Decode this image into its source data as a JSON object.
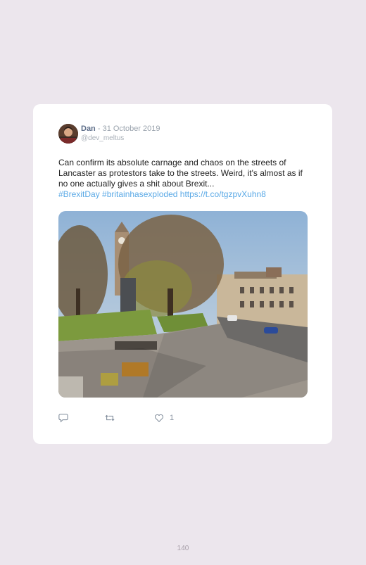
{
  "tweet": {
    "author": "Dan",
    "date": "31 October 2019",
    "handle": "@dev_meltus",
    "text": "Can confirm its absolute carnage and chaos on the streets of Lancaster as protestors take to the streets. Weird, it's almost as if no one actually gives a shit about Brexit...",
    "hashtags": "#BrexitDay #britainhasexploded",
    "url": "https://t.co/tgzpvXuhn8",
    "like_count": "1"
  },
  "icons": {
    "reply": "speech-bubble-icon",
    "retweet": "retweet-icon",
    "like": "heart-icon"
  },
  "colors": {
    "background": "#ece6ed",
    "card": "#ffffff",
    "link": "#5aa9e6",
    "author": "#5f6f8a"
  },
  "page": {
    "number": "140"
  }
}
